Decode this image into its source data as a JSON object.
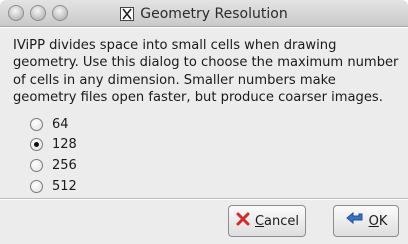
{
  "window": {
    "title": "Geometry Resolution"
  },
  "description": "IViPP divides space into small cells when drawing geometry. Use this dialog to choose the maximum number of cells in any dimension. Smaller numbers make geometry files open faster, but produce coarser images.",
  "options": [
    {
      "label": "64",
      "selected": false
    },
    {
      "label": "128",
      "selected": true
    },
    {
      "label": "256",
      "selected": false
    },
    {
      "label": "512",
      "selected": false
    }
  ],
  "buttons": {
    "cancel": {
      "mnemonic": "C",
      "rest": "ancel",
      "icon": "cancel-x-icon"
    },
    "ok": {
      "mnemonic": "O",
      "rest": "K",
      "icon": "arrow-left-icon"
    }
  },
  "colors": {
    "cancel_icon": "#d22b2b",
    "ok_icon": "#3a73c4"
  }
}
